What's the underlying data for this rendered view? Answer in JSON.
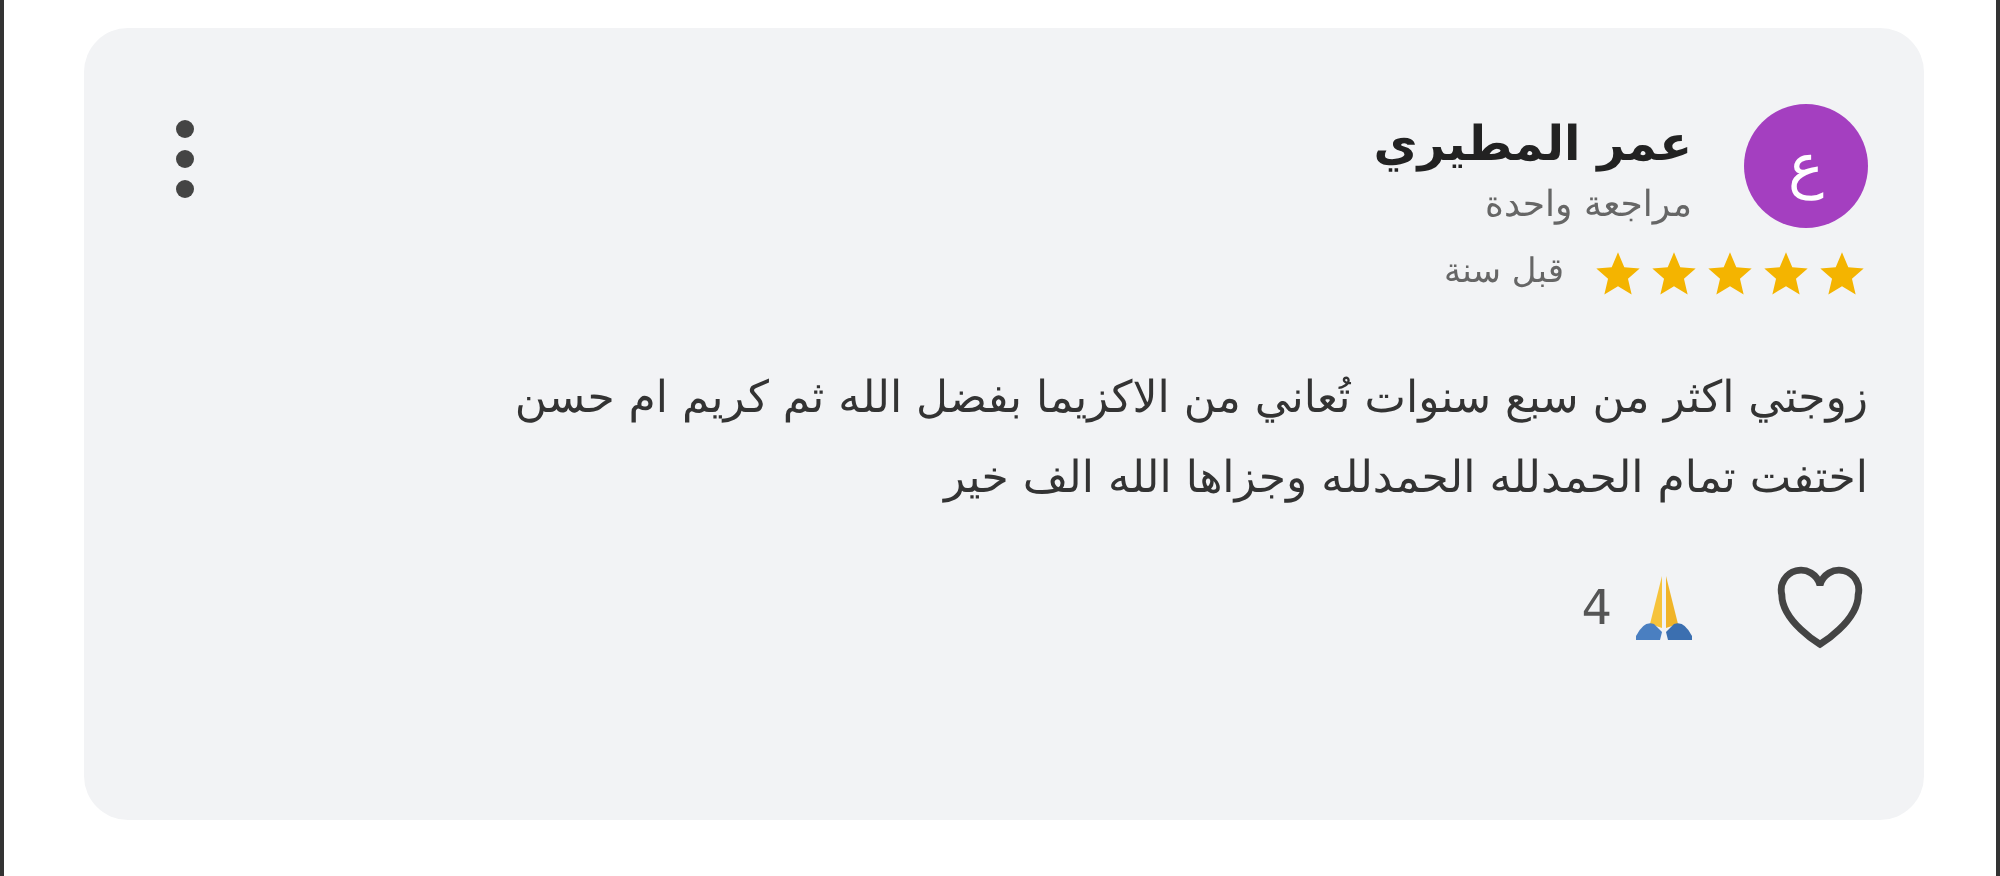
{
  "review": {
    "avatar_letter": "ع",
    "color": "#a43fc0",
    "author": "عمر المطيري",
    "subtitle": "مراجعة واحدة",
    "stars": 5,
    "time": "قبل سنة",
    "text_lines": [
      "زوجتي اكثر من سبع سنوات تُعاني من الاكزيما بفضل الله ثم كريم ام حسن",
      "اختفت تمام الحمدلله الحمدلله وجزاها الله الف خير"
    ],
    "liked": false,
    "reaction_count": "4"
  }
}
